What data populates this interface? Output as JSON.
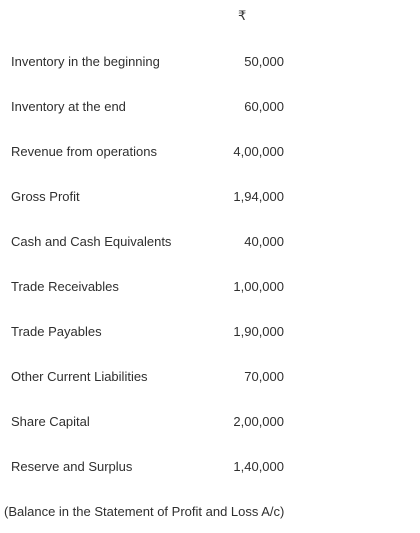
{
  "currency_symbol": "₹",
  "rows": [
    {
      "label": "Inventory in the beginning",
      "value": "50,000"
    },
    {
      "label": "Inventory at the end",
      "value": "60,000"
    },
    {
      "label": "Revenue from operations",
      "value": "4,00,000"
    },
    {
      "label": "Gross Profit",
      "value": "1,94,000"
    },
    {
      "label": "Cash and Cash Equivalents",
      "value": "40,000"
    },
    {
      "label": "Trade Receivables",
      "value": "1,00,000"
    },
    {
      "label": "Trade Payables",
      "value": "1,90,000"
    },
    {
      "label": "Other Current Liabilities",
      "value": "70,000"
    },
    {
      "label": "Share Capital",
      "value": "2,00,000"
    },
    {
      "label": "Reserve and Surplus",
      "value": "1,40,000"
    }
  ],
  "footnote": "(Balance in the Statement of Profit and Loss A/c)"
}
